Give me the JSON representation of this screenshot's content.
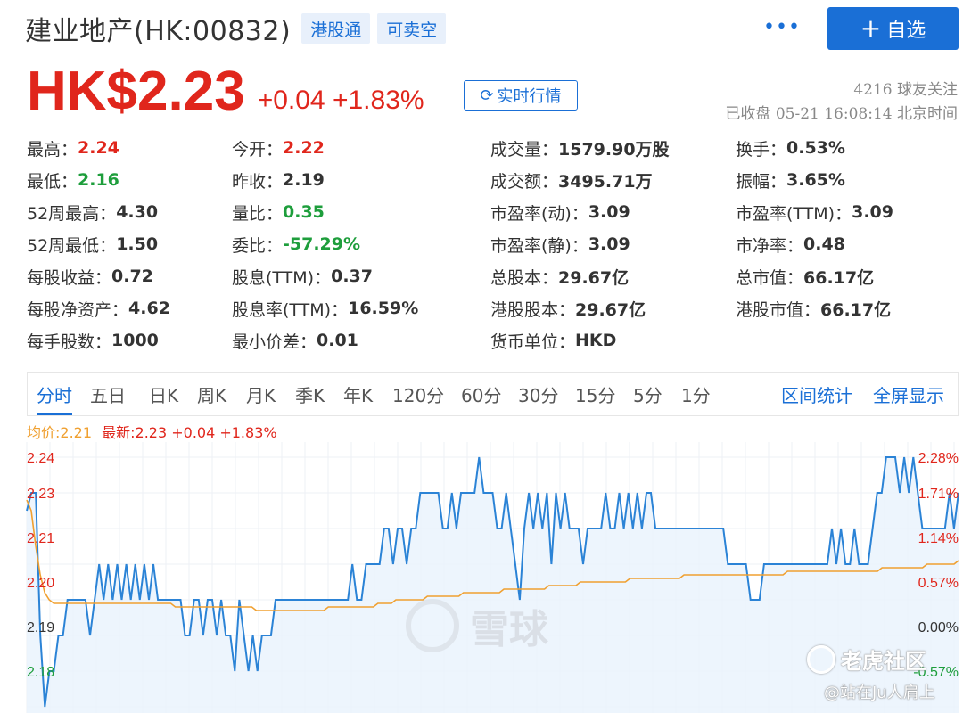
{
  "header": {
    "stock_name": "建业地产(HK:00832)",
    "tags": [
      "港股通",
      "可卖空"
    ],
    "more_label": "•••",
    "follow_label": "自选",
    "follow_plus": "+"
  },
  "price": {
    "value": "HK$2.23",
    "change": "+0.04",
    "change_pct": "+1.83%",
    "realtime_label": "实时行情",
    "followers": "4216 球友关注",
    "status": "已收盘 05-21 16:08:14 北京时间"
  },
  "quote": [
    [
      {
        "label": "最高：",
        "value": "2.24",
        "tone": "up"
      },
      {
        "label": "今开：",
        "value": "2.22",
        "tone": "up"
      },
      {
        "label": "成交量：",
        "value": "1579.90万股",
        "tone": ""
      },
      {
        "label": "换手：",
        "value": "0.53%",
        "tone": ""
      }
    ],
    [
      {
        "label": "最低：",
        "value": "2.16",
        "tone": "down"
      },
      {
        "label": "昨收：",
        "value": "2.19",
        "tone": ""
      },
      {
        "label": "成交额：",
        "value": "3495.71万",
        "tone": ""
      },
      {
        "label": "振幅：",
        "value": "3.65%",
        "tone": ""
      }
    ],
    [
      {
        "label": "52周最高：",
        "value": "4.30",
        "tone": ""
      },
      {
        "label": "量比：",
        "value": "0.35",
        "tone": "down"
      },
      {
        "label": "市盈率(动)：",
        "value": "3.09",
        "tone": ""
      },
      {
        "label": "市盈率(TTM)：",
        "value": "3.09",
        "tone": ""
      }
    ],
    [
      {
        "label": "52周最低：",
        "value": "1.50",
        "tone": ""
      },
      {
        "label": "委比：",
        "value": "-57.29%",
        "tone": "down"
      },
      {
        "label": "市盈率(静)：",
        "value": "3.09",
        "tone": ""
      },
      {
        "label": "市净率：",
        "value": "0.48",
        "tone": ""
      }
    ],
    [
      {
        "label": "每股收益：",
        "value": "0.72",
        "tone": ""
      },
      {
        "label": "股息(TTM)：",
        "value": "0.37",
        "tone": ""
      },
      {
        "label": "总股本：",
        "value": "29.67亿",
        "tone": ""
      },
      {
        "label": "总市值：",
        "value": "66.17亿",
        "tone": ""
      }
    ],
    [
      {
        "label": "每股净资产：",
        "value": "4.62",
        "tone": ""
      },
      {
        "label": "股息率(TTM)：",
        "value": "16.59%",
        "tone": ""
      },
      {
        "label": "港股股本：",
        "value": "29.67亿",
        "tone": ""
      },
      {
        "label": "港股市值：",
        "value": "66.17亿",
        "tone": ""
      }
    ],
    [
      {
        "label": "每手股数：",
        "value": "1000",
        "tone": ""
      },
      {
        "label": "最小价差：",
        "value": "0.01",
        "tone": ""
      },
      {
        "label": "货币单位：",
        "value": "HKD",
        "tone": ""
      },
      null
    ]
  ],
  "tabs": [
    "分时",
    "五日",
    "日K",
    "周K",
    "月K",
    "季K",
    "年K",
    "120分",
    "60分",
    "30分",
    "15分",
    "5分",
    "1分"
  ],
  "tab_links": [
    "区间统计",
    "全屏显示"
  ],
  "legend": {
    "avg": "均价:2.21",
    "latest": "最新:2.23 +0.04 +1.83%"
  },
  "watermarks": {
    "xueqiu": "雪球",
    "tiger": "老虎社区",
    "author": "@站在Ju人肩上"
  },
  "colors": {
    "accent": "#1a6fd6",
    "up": "#e0261c",
    "down": "#1e9e3c",
    "avg_line": "#f0a030"
  },
  "chart_data": {
    "type": "line",
    "y_left_ticks": [
      "2.24",
      "2.23",
      "2.21",
      "2.20",
      "2.19",
      "2.18"
    ],
    "y_right_ticks": [
      "2.28%",
      "1.71%",
      "1.14%",
      "0.57%",
      "0.00%",
      "-0.57%"
    ],
    "ylim": [
      2.165,
      2.245
    ],
    "series": [
      {
        "name": "最新",
        "color": "#2b83d6",
        "values": [
          2.225,
          2.23,
          2.23,
          2.19,
          2.17,
          2.18,
          2.18,
          2.19,
          2.19,
          2.2,
          2.2,
          2.2,
          2.2,
          2.2,
          2.19,
          2.2,
          2.21,
          2.2,
          2.21,
          2.2,
          2.21,
          2.2,
          2.21,
          2.2,
          2.21,
          2.2,
          2.21,
          2.2,
          2.21,
          2.2,
          2.2,
          2.2,
          2.2,
          2.2,
          2.2,
          2.19,
          2.19,
          2.2,
          2.2,
          2.19,
          2.2,
          2.2,
          2.19,
          2.2,
          2.19,
          2.19,
          2.18,
          2.2,
          2.19,
          2.18,
          2.19,
          2.18,
          2.19,
          2.19,
          2.19,
          2.2,
          2.2,
          2.2,
          2.2,
          2.2,
          2.2,
          2.2,
          2.2,
          2.2,
          2.2,
          2.2,
          2.2,
          2.2,
          2.2,
          2.2,
          2.2,
          2.2,
          2.21,
          2.2,
          2.2,
          2.21,
          2.21,
          2.21,
          2.21,
          2.22,
          2.22,
          2.21,
          2.22,
          2.22,
          2.21,
          2.22,
          2.22,
          2.23,
          2.23,
          2.23,
          2.23,
          2.23,
          2.22,
          2.22,
          2.23,
          2.22,
          2.23,
          2.23,
          2.23,
          2.23,
          2.24,
          2.23,
          2.23,
          2.23,
          2.22,
          2.22,
          2.23,
          2.22,
          2.21,
          2.2,
          2.22,
          2.23,
          2.22,
          2.23,
          2.22,
          2.23,
          2.21,
          2.23,
          2.22,
          2.23,
          2.22,
          2.22,
          2.22,
          2.21,
          2.22,
          2.22,
          2.22,
          2.22,
          2.23,
          2.22,
          2.22,
          2.23,
          2.22,
          2.23,
          2.22,
          2.23,
          2.22,
          2.23,
          2.23,
          2.22,
          2.22,
          2.22,
          2.22,
          2.22,
          2.22,
          2.22,
          2.22,
          2.22,
          2.22,
          2.22,
          2.22,
          2.22,
          2.22,
          2.22,
          2.22,
          2.21,
          2.21,
          2.21,
          2.21,
          2.21,
          2.2,
          2.2,
          2.2,
          2.21,
          2.21,
          2.21,
          2.21,
          2.21,
          2.21,
          2.21,
          2.21,
          2.21,
          2.21,
          2.21,
          2.21,
          2.21,
          2.21,
          2.21,
          2.22,
          2.21,
          2.22,
          2.21,
          2.21,
          2.22,
          2.21,
          2.21,
          2.21,
          2.22,
          2.23,
          2.23,
          2.24,
          2.24,
          2.24,
          2.23,
          2.24,
          2.23,
          2.24,
          2.23,
          2.22,
          2.22,
          2.22,
          2.22,
          2.22,
          2.22,
          2.23,
          2.22,
          2.23
        ]
      },
      {
        "name": "均价",
        "color": "#f0a030",
        "values": [
          2.228,
          2.225,
          2.215,
          2.207,
          2.202,
          2.2,
          2.199,
          2.199,
          2.199,
          2.199,
          2.199,
          2.199,
          2.199,
          2.199,
          2.199,
          2.199,
          2.199,
          2.199,
          2.199,
          2.199,
          2.199,
          2.199,
          2.199,
          2.199,
          2.199,
          2.199,
          2.199,
          2.199,
          2.199,
          2.199,
          2.199,
          2.199,
          2.199,
          2.198,
          2.198,
          2.198,
          2.198,
          2.198,
          2.198,
          2.198,
          2.198,
          2.198,
          2.198,
          2.198,
          2.198,
          2.198,
          2.198,
          2.198,
          2.198,
          2.198,
          2.198,
          2.197,
          2.197,
          2.197,
          2.197,
          2.197,
          2.197,
          2.197,
          2.197,
          2.197,
          2.197,
          2.197,
          2.197,
          2.197,
          2.197,
          2.197,
          2.197,
          2.198,
          2.198,
          2.198,
          2.198,
          2.198,
          2.198,
          2.198,
          2.198,
          2.198,
          2.198,
          2.198,
          2.199,
          2.199,
          2.199,
          2.199,
          2.2,
          2.2,
          2.2,
          2.2,
          2.2,
          2.2,
          2.2,
          2.201,
          2.201,
          2.201,
          2.201,
          2.201,
          2.201,
          2.201,
          2.201,
          2.202,
          2.202,
          2.202,
          2.202,
          2.202,
          2.202,
          2.202,
          2.202,
          2.202,
          2.203,
          2.203,
          2.203,
          2.203,
          2.203,
          2.203,
          2.203,
          2.203,
          2.203,
          2.203,
          2.204,
          2.204,
          2.204,
          2.204,
          2.204,
          2.204,
          2.204,
          2.205,
          2.205,
          2.205,
          2.205,
          2.205,
          2.205,
          2.205,
          2.205,
          2.205,
          2.205,
          2.205,
          2.206,
          2.206,
          2.206,
          2.206,
          2.206,
          2.206,
          2.206,
          2.206,
          2.206,
          2.206,
          2.206,
          2.206,
          2.207,
          2.207,
          2.207,
          2.207,
          2.207,
          2.207,
          2.207,
          2.207,
          2.207,
          2.207,
          2.207,
          2.207,
          2.207,
          2.207,
          2.207,
          2.207,
          2.207,
          2.207,
          2.207,
          2.207,
          2.207,
          2.207,
          2.207,
          2.208,
          2.208,
          2.208,
          2.208,
          2.208,
          2.208,
          2.208,
          2.208,
          2.208,
          2.208,
          2.208,
          2.208,
          2.208,
          2.208,
          2.208,
          2.208,
          2.208,
          2.208,
          2.208,
          2.208,
          2.208,
          2.209,
          2.209,
          2.209,
          2.209,
          2.209,
          2.209,
          2.209,
          2.209,
          2.209,
          2.209,
          2.21,
          2.21,
          2.21,
          2.21,
          2.21,
          2.21,
          2.21,
          2.211
        ]
      }
    ]
  }
}
